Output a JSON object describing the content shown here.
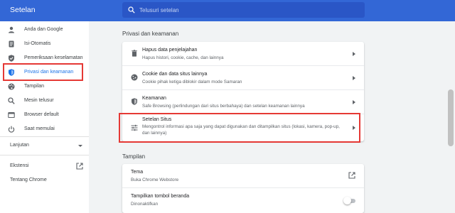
{
  "header": {
    "title": "Setelan",
    "search_placeholder": "Telusuri setelan"
  },
  "sidebar": {
    "items": [
      {
        "label": "Anda dan Google",
        "icon": "person-icon"
      },
      {
        "label": "Isi-Otomatis",
        "icon": "autofill-icon"
      },
      {
        "label": "Pemeriksaan keselamatan",
        "icon": "safety-check-icon"
      },
      {
        "label": "Privasi dan keamanan",
        "icon": "shield-icon",
        "active": true
      },
      {
        "label": "Tampilan",
        "icon": "palette-icon"
      },
      {
        "label": "Mesin telusur",
        "icon": "search-icon"
      },
      {
        "label": "Browser default",
        "icon": "browser-icon"
      },
      {
        "label": "Saat memulai",
        "icon": "power-icon"
      }
    ],
    "advanced_label": "Lanjutan",
    "extensions_label": "Ekstensi",
    "about_label": "Tentang Chrome"
  },
  "privacy": {
    "section_title": "Privasi dan keamanan",
    "rows": [
      {
        "title": "Hapus data penjelajahan",
        "subtitle": "Hapus histori, cookie, cache, dan lainnya",
        "icon": "trash-icon"
      },
      {
        "title": "Cookie dan data situs lainnya",
        "subtitle": "Cookie pihak ketiga diblokir dalam mode Samaran",
        "icon": "cookie-icon"
      },
      {
        "title": "Keamanan",
        "subtitle": "Safe Browsing (perlindungan dari situs berbahaya) dan setelan keamanan lainnya",
        "icon": "shield-icon"
      },
      {
        "title": "Setelan Situs",
        "subtitle": "Mengontrol informasi apa saja yang dapat digunakan dan ditampilkan situs (lokasi, kamera, pop-up, dan lainnya)",
        "icon": "tune-icon"
      }
    ]
  },
  "appearance": {
    "section_title": "Tampilan",
    "rows": [
      {
        "title": "Tema",
        "subtitle": "Buka Chrome Webstore"
      },
      {
        "title": "Tampilkan tombol beranda",
        "subtitle": "Dinonaktifkan",
        "toggle_on": false
      }
    ]
  },
  "colors": {
    "header": "#3367d6",
    "accent": "#1a73e8",
    "highlight": "#e53935"
  }
}
